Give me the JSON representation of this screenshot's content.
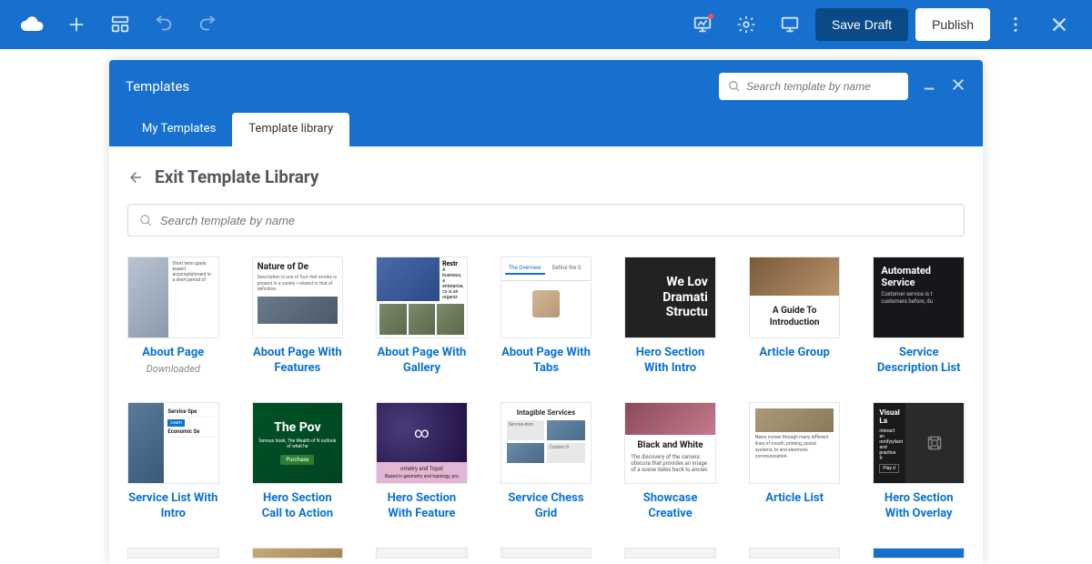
{
  "topbar": {
    "save_label": "Save Draft",
    "publish_label": "Publish"
  },
  "modal": {
    "title": "Templates",
    "search_placeholder": "Search template by name",
    "tabs": {
      "my": "My Templates",
      "library": "Template library"
    },
    "exit_title": "Exit Template Library",
    "body_search_placeholder": "Search template by name"
  },
  "templates_row1": [
    {
      "title": "About Page",
      "sub": "Downloaded"
    },
    {
      "title": "About Page With Features"
    },
    {
      "title": "About Page With Gallery"
    },
    {
      "title": "About Page With Tabs"
    },
    {
      "title": "Hero Section With Intro"
    },
    {
      "title": "Article Group"
    },
    {
      "title": "Service Description List"
    }
  ],
  "templates_row2": [
    {
      "title": "Service List With Intro"
    },
    {
      "title": "Hero Section Call to Action"
    },
    {
      "title": "Hero Section With Feature"
    },
    {
      "title": "Service Chess Grid"
    },
    {
      "title": "Showcase Creative"
    },
    {
      "title": "Article List"
    },
    {
      "title": "Hero Section With Overlay"
    }
  ],
  "thumbs": {
    "nature": "Nature of De",
    "nature_p": "Description is one of four rhet modes is present in a variety r related to that of definition.",
    "restr": "Restr",
    "tab_ov": "The Overview",
    "tab_df": "Define the S",
    "hero_intro": "We Lov Dramati Structu",
    "guide": "A Guide To Introduction",
    "auto_h": "Automated Service",
    "auto_p": "Customer service is t customers before, du",
    "svc_spec": "Service Spe",
    "svc_econ": "Economic Se",
    "cta_t": "The Pov",
    "cta_s": "famous book, The Wealth of N outlook of what he",
    "cta_b": "Purchase",
    "ft_bar": "ometry and Topol",
    "ft_bar2": "Based in geometry and topology, pro",
    "chess_h": "Intagible Services",
    "chess_c": "Custom S",
    "bw_h": "Black and White",
    "bw_p": "The discovery of the camera obscura that provides an image of a scene dates back to ancien",
    "al_p": "News moves through many different lines of mouth, printing, postal systems, br and electronic communication.",
    "ov_h": "Visual La",
    "ov_b": "Play d"
  }
}
